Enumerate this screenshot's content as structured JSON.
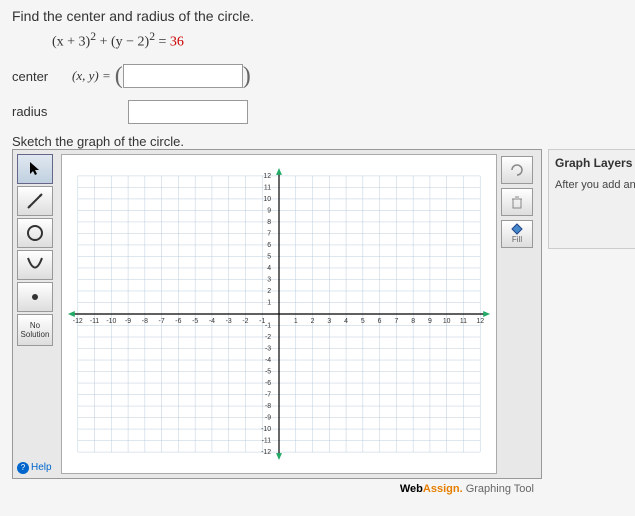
{
  "question": {
    "prompt": "Find the center and radius of the circle.",
    "equation_prefix": "(x + 3)",
    "equation_sup1": "2",
    "equation_mid": " + (y − 2)",
    "equation_sup2": "2",
    "equation_eq": " = ",
    "equation_rhs": "36",
    "center_label": "center",
    "xy_label": "(x, y) = ",
    "center_value": "",
    "radius_label": "radius",
    "radius_value": "",
    "sketch_label": "Sketch the graph of the circle."
  },
  "tools": {
    "pointer": "pointer",
    "line": "line",
    "circle": "circle",
    "curve": "curve",
    "point": "point",
    "no_solution": "No Solution",
    "help": "Help"
  },
  "right_tools": {
    "clear": "",
    "delete": "",
    "fill": "Fill"
  },
  "chart_data": {
    "type": "scatter",
    "title": "",
    "xlabel": "",
    "ylabel": "",
    "xlim": [
      -12,
      12
    ],
    "ylim": [
      -12,
      12
    ],
    "x_ticks": [
      -12,
      -11,
      -10,
      -9,
      -8,
      -7,
      -6,
      -5,
      -4,
      -3,
      -2,
      -1,
      1,
      2,
      3,
      4,
      5,
      6,
      7,
      8,
      9,
      10,
      11,
      12
    ],
    "y_ticks": [
      -12,
      -11,
      -10,
      -9,
      -8,
      -7,
      -6,
      -5,
      -4,
      -3,
      -2,
      -1,
      1,
      2,
      3,
      4,
      5,
      6,
      7,
      8,
      9,
      10,
      11,
      12
    ],
    "series": []
  },
  "layers": {
    "title": "Graph Layers",
    "text": "After you add an object to the graph can use Graph Layers to view and e properties."
  },
  "footer": {
    "brand1": "Web",
    "brand2": "Assign.",
    "tool": " Graphing Tool"
  }
}
